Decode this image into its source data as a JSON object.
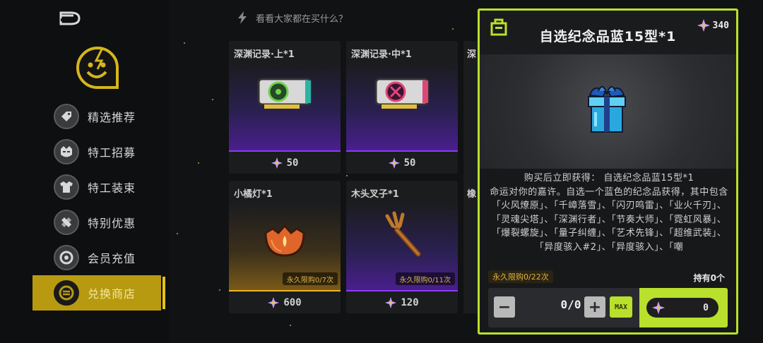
{
  "hint": {
    "text": "看看大家都在买什么？"
  },
  "sidebar": {
    "items": [
      {
        "label": "精选推荐",
        "icon": "tag-icon"
      },
      {
        "label": "特工招募",
        "icon": "agent-icon"
      },
      {
        "label": "特工装束",
        "icon": "outfit-icon"
      },
      {
        "label": "特别优惠",
        "icon": "discount-icon"
      },
      {
        "label": "会员充值",
        "icon": "vip-icon"
      },
      {
        "label": "兑换商店",
        "icon": "exchange-icon",
        "active": true
      }
    ]
  },
  "cards": [
    {
      "title": "深渊记录·上*1",
      "price": "50",
      "limit": ""
    },
    {
      "title": "深渊记录·中*1",
      "price": "50",
      "limit": ""
    },
    {
      "title": "小橘灯*1",
      "price": "600",
      "limit": "永久限购0/7次"
    },
    {
      "title": "木头叉子*1",
      "price": "120",
      "limit": "永久限购0/11次"
    }
  ],
  "partial_cards": [
    {
      "title_fragment": "深"
    },
    {
      "title_fragment": "橡"
    }
  ],
  "detail": {
    "title": "自选纪念品蓝15型*1",
    "currency": "340",
    "description": "购买后立即获得： 自选纪念品蓝15型*1\n命运对你的嘉许。自选一个蓝色的纪念品获得，其中包含「火风燎原」、「千嶂落雪」、「闪刃鸣雷」、「业火千刃」、「灵魂尖塔」、「深渊行者」、「节奏大师」、「霓虹风暴」、「爆裂螺旋」、「量子纠缠」、「艺术先锋」、「超维武装」、「异度骇入#2」、「异度骇入」、「嘲",
    "limit": "永久限购0/22次",
    "owned": "持有0个",
    "quantity": "0/0",
    "max_label": "MAX",
    "total": "0",
    "minus": "−",
    "plus": "+"
  },
  "colors": {
    "accent": "#b9e02c",
    "gold": "#e6c21a",
    "purple": "#8a3df0"
  }
}
